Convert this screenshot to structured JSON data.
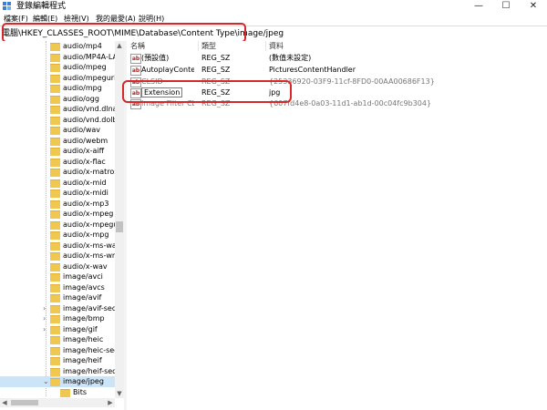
{
  "window": {
    "title": "登錄編輯程式",
    "minimize_glyph": "—",
    "maximize_glyph": "☐",
    "close_glyph": "✕"
  },
  "menu": [
    "檔案(F)",
    "編輯(E)",
    "檢視(V)",
    "我的最愛(A)",
    "說明(H)"
  ],
  "address": "電腦\\HKEY_CLASSES_ROOT\\MIME\\Database\\Content Type\\image/jpeg",
  "tree": {
    "items": [
      {
        "label": "audio/mp4"
      },
      {
        "label": "audio/MP4A-LA"
      },
      {
        "label": "audio/mpeg"
      },
      {
        "label": "audio/mpegurl"
      },
      {
        "label": "audio/mpg"
      },
      {
        "label": "audio/ogg"
      },
      {
        "label": "audio/vnd.dlna"
      },
      {
        "label": "audio/vnd.dolb"
      },
      {
        "label": "audio/wav"
      },
      {
        "label": "audio/webm"
      },
      {
        "label": "audio/x-aiff"
      },
      {
        "label": "audio/x-flac"
      },
      {
        "label": "audio/x-matros"
      },
      {
        "label": "audio/x-mid"
      },
      {
        "label": "audio/x-midi"
      },
      {
        "label": "audio/x-mp3"
      },
      {
        "label": "audio/x-mpeg"
      },
      {
        "label": "audio/x-mpegu"
      },
      {
        "label": "audio/x-mpg"
      },
      {
        "label": "audio/x-ms-wa"
      },
      {
        "label": "audio/x-ms-wm"
      },
      {
        "label": "audio/x-wav"
      },
      {
        "label": "image/avci"
      },
      {
        "label": "image/avcs"
      },
      {
        "label": "image/avif"
      },
      {
        "label": "image/avif-seq"
      },
      {
        "label": "image/bmp"
      },
      {
        "label": "image/gif"
      },
      {
        "label": "image/heic"
      },
      {
        "label": "image/heic-seq"
      },
      {
        "label": "image/heif"
      },
      {
        "label": "image/heif-seq"
      },
      {
        "label": "image/jpeg"
      },
      {
        "label": "Bits"
      }
    ],
    "expand_glyph": "›",
    "collapse_glyph": "⌄"
  },
  "list": {
    "columns": {
      "name": "名稱",
      "type": "類型",
      "data": "資料"
    },
    "rows": [
      {
        "name": "(預設值)",
        "type": "REG_SZ",
        "data": "(數值未設定)"
      },
      {
        "name": "AutoplayConte...",
        "type": "REG_SZ",
        "data": "PicturesContentHandler"
      },
      {
        "name": "CLSID",
        "type": "REG_SZ",
        "data": "{25336920-03F9-11cf-8FD0-00AA00686F13}"
      },
      {
        "name": "Extension",
        "type": "REG_SZ",
        "data": "jpg"
      },
      {
        "name": "Image Filter CL...",
        "type": "REG_SZ",
        "data": "{607fd4e8-0a03-11d1-ab1d-00c04fc9b304}"
      }
    ],
    "value_icon_text": "ab"
  },
  "colors": {
    "highlight": "#d62828",
    "selection": "#cce4f7",
    "folder": "#f0c850"
  }
}
